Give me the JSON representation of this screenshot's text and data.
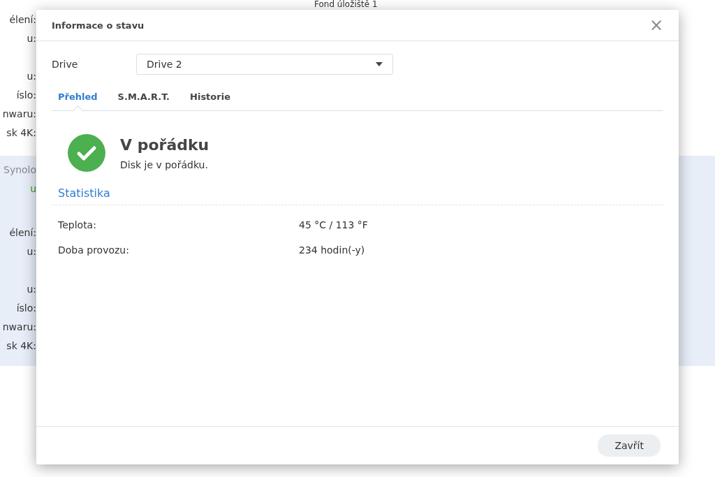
{
  "background": {
    "top_value": "Fond úložiště 1",
    "groups": [
      {
        "highlighted": false,
        "labels": [
          "élení:",
          "u:",
          "u:",
          "íslo:",
          "nwaru:",
          "sk 4K:"
        ]
      },
      {
        "highlighted": true,
        "title": "Synolo",
        "status": "u",
        "labels": [
          "élení:",
          "u:",
          "u:",
          "íslo:",
          "nwaru:",
          "sk 4K:"
        ]
      }
    ]
  },
  "dialog": {
    "title": "Informace o stavu",
    "close": "×",
    "drive": {
      "label": "Drive",
      "value": "Drive 2"
    },
    "tabs": [
      {
        "label": "Přehled",
        "selected": true
      },
      {
        "label": "S.M.A.R.T.",
        "selected": false
      },
      {
        "label": "Historie",
        "selected": false
      }
    ],
    "status": {
      "kind": "ok",
      "title": "V pořádku",
      "message": "Disk je v pořádku."
    },
    "section": "Statistika",
    "stats": [
      {
        "label": "Teplota:",
        "value": "45 °C / 113 °F"
      },
      {
        "label": "Doba provozu:",
        "value": "234 hodin(-y)"
      }
    ],
    "buttons": [
      "Zavřít"
    ]
  }
}
